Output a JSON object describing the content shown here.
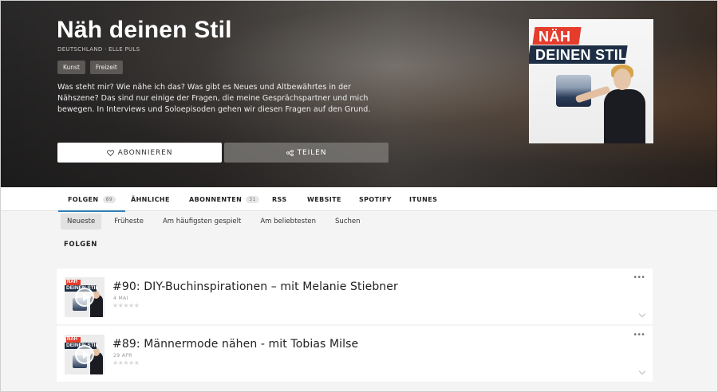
{
  "podcast": {
    "title": "Näh deinen Stil",
    "meta": "DEUTSCHLAND · ELLE PULS",
    "tags": [
      "Kunst",
      "Freizeit"
    ],
    "description": "Was steht mir? Wie nähe ich das? Was gibt es Neues und Altbewährtes in der Nähszene? Das sind nur einige der Fragen, die meine Gesprächspartner und mich bewegen. In Interviews und Soloepisoden gehen wir diesen Fragen auf den Grund.",
    "subscribe_label": "ABONNIEREN",
    "share_label": "TEILEN",
    "cover": {
      "line1": "NÄH",
      "line2": "DEINEN STIL"
    }
  },
  "nav": {
    "tabs": [
      {
        "label": "FOLGEN",
        "count": "89",
        "active": true
      },
      {
        "label": "ÄHNLICHE"
      },
      {
        "label": "ABONNENTEN",
        "count": "31"
      },
      {
        "label": "RSS"
      },
      {
        "label": "WEBSITE"
      },
      {
        "label": "SPOTIFY"
      },
      {
        "label": "ITUNES"
      }
    ]
  },
  "sort": {
    "options": [
      "Neueste",
      "Früheste",
      "Am häufigsten gespielt",
      "Am beliebtesten",
      "Suchen"
    ],
    "active": "Neueste"
  },
  "section_title": "FOLGEN",
  "episodes": [
    {
      "title": "#90: DIY-Buchinspirationen – mit Melanie Stiebner",
      "date": "4 MAI",
      "rating": 0
    },
    {
      "title": "#89: Männermode nähen - mit Tobias Milse",
      "date": "29 APR",
      "rating": 0
    }
  ],
  "icons": {
    "subscribe": "heart-icon",
    "share": "share-icon",
    "more": "more-dots-icon",
    "expand": "chevron-down-icon",
    "play": "play-icon"
  },
  "colors": {
    "accent": "#2f7fb7",
    "brand_red": "#e53c2c",
    "brand_navy": "#1e2f45"
  }
}
